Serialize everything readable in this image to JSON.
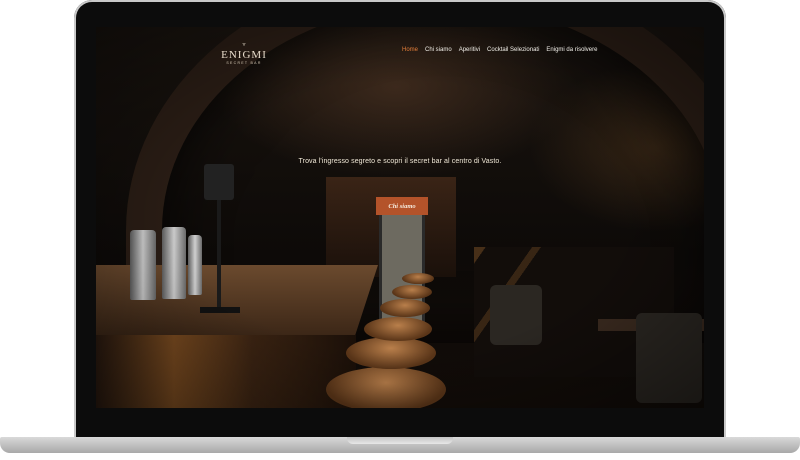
{
  "site": {
    "logo_title": "ENIGMI",
    "logo_subtitle": "SECRET BAR"
  },
  "nav": {
    "items": [
      "Home",
      "Chi siamo",
      "Aperitivi",
      "Cocktail Selezionati",
      "Enigmi da risolvere"
    ],
    "active_index": 0
  },
  "hero": {
    "tagline": "Trova l'ingresso segreto e scopri il secret bar al centro di Vasto.",
    "cta_label": "Chi siamo"
  },
  "colors": {
    "accent": "#e47d3a",
    "cta_bg": "#b4532a",
    "text": "#efe7d6"
  }
}
